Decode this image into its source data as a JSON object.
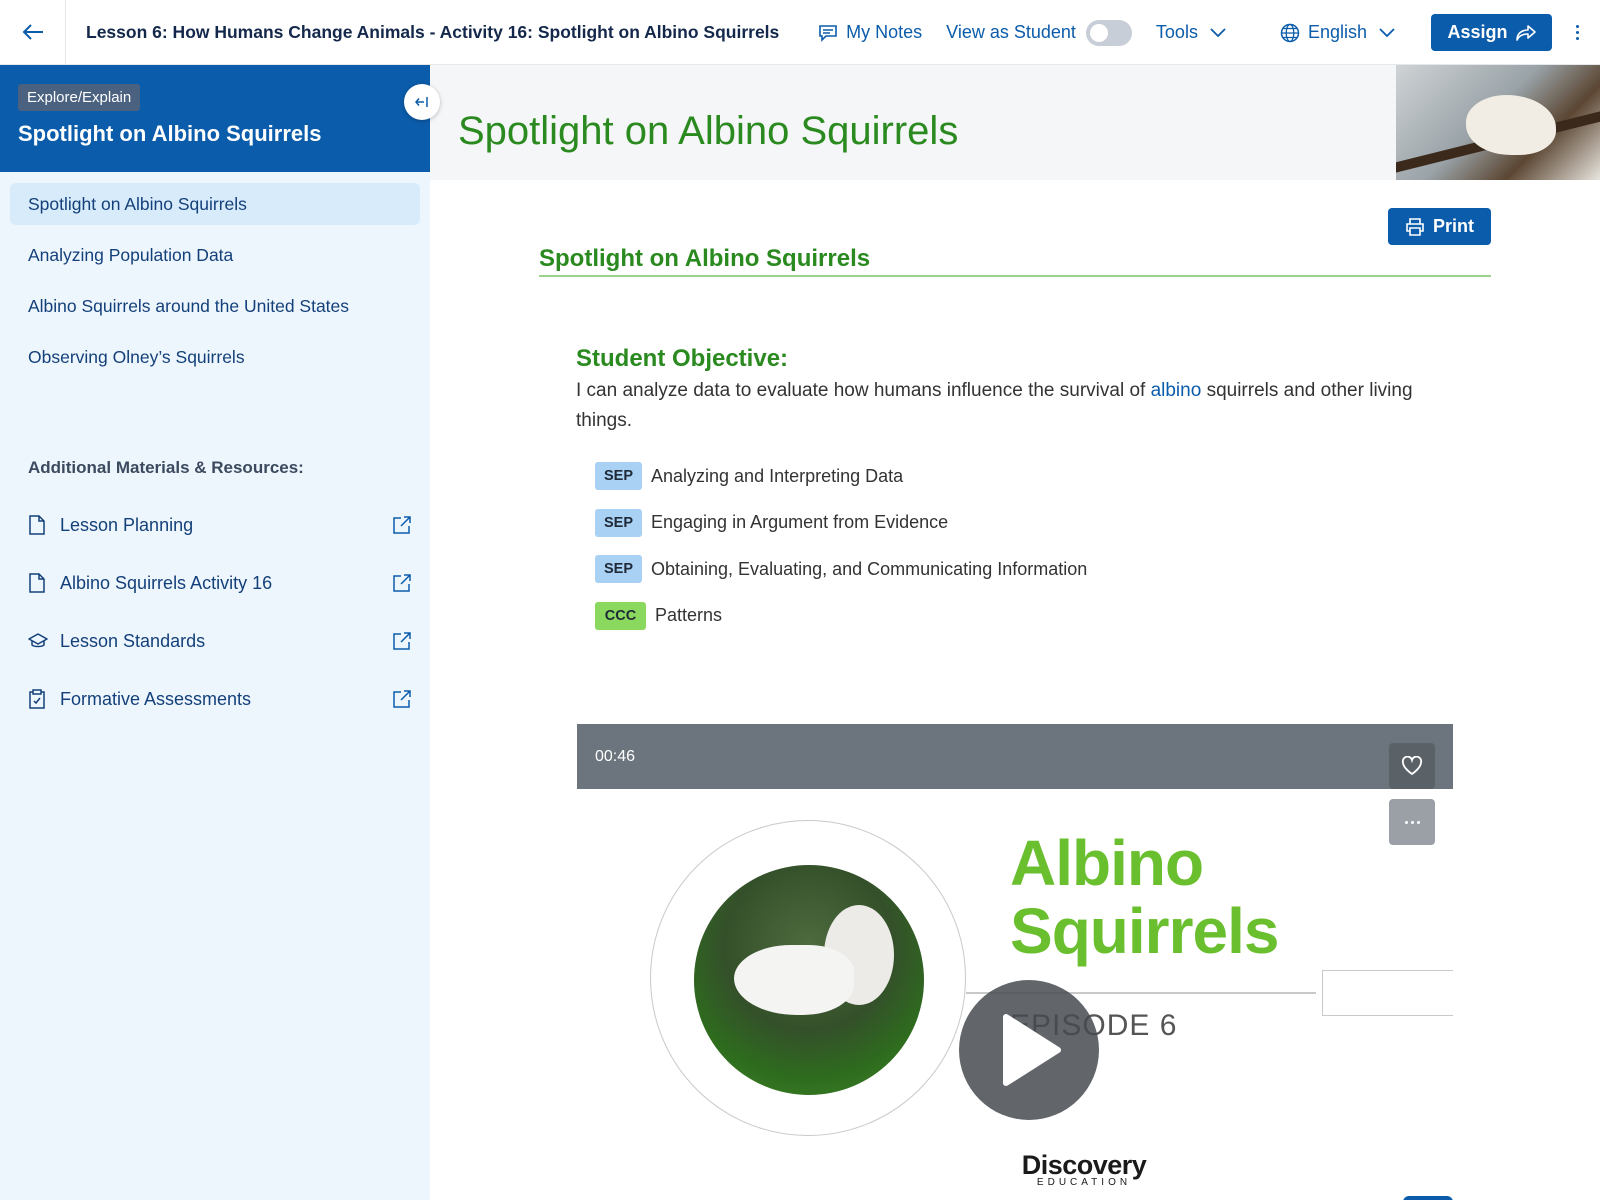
{
  "topbar": {
    "lesson_title": "Lesson 6: How Humans Change Animals - Activity 16: Spotlight on Albino Squirrels",
    "my_notes": "My Notes",
    "view_as_student": "View as Student",
    "tools": "Tools",
    "language": "English",
    "assign": "Assign"
  },
  "sidebar": {
    "phase": "Explore/Explain",
    "title": "Spotlight on Albino Squirrels",
    "items": [
      {
        "label": "Spotlight on Albino Squirrels",
        "active": true
      },
      {
        "label": "Analyzing Population Data"
      },
      {
        "label": "Albino Squirrels around the United States"
      },
      {
        "label": "Observing Olney’s Squirrels"
      }
    ],
    "resources_heading": "Additional Materials & Resources:",
    "resources": [
      {
        "label": "Lesson Planning",
        "icon": "document-icon"
      },
      {
        "label": "Albino Squirrels Activity 16",
        "icon": "document-icon"
      },
      {
        "label": "Lesson Standards",
        "icon": "graduation-cap-icon"
      },
      {
        "label": "Formative Assessments",
        "icon": "clipboard-icon"
      }
    ]
  },
  "main": {
    "hero_title": "Spotlight on Albino Squirrels",
    "print": "Print",
    "section_title": "Spotlight on Albino Squirrels",
    "objective_heading": "Student Objective:",
    "objective_before": "I can analyze data to evaluate how humans influence the survival of ",
    "objective_link": "albino",
    "objective_after": " squirrels and other living things.",
    "tags": [
      {
        "type": "SEP",
        "label": "Analyzing and Interpreting Data"
      },
      {
        "type": "SEP",
        "label": "Engaging in Argument from Evidence"
      },
      {
        "type": "SEP",
        "label": "Obtaining, Evaluating, and Communicating Information"
      },
      {
        "type": "CCC",
        "label": "Patterns"
      }
    ],
    "video": {
      "duration": "00:46",
      "title_line1": "Albino",
      "title_line2": "Squirrels",
      "episode": "EPISODE 6",
      "logo_main": "Discovery",
      "logo_sub": "EDUCATION"
    }
  },
  "colors": {
    "brand_blue": "#0b5cab",
    "heading_green": "#2a8a1f",
    "sep_tag": "#a9d1f3",
    "ccc_tag": "#8bd85f"
  }
}
